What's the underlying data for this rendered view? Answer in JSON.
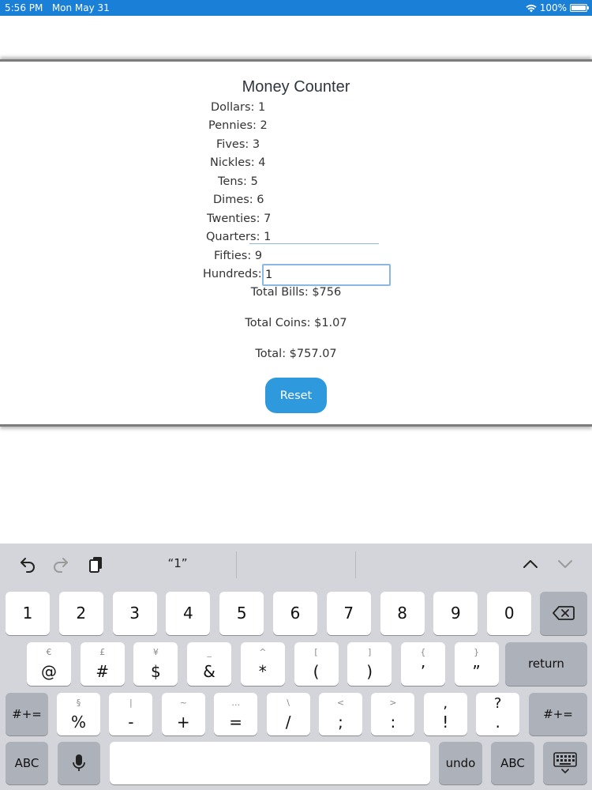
{
  "status_bar": {
    "time": "5:56 PM",
    "date": "Mon May 31",
    "battery": "100%",
    "wifi_icon": "wifi-icon",
    "battery_icon": "battery-icon"
  },
  "app": {
    "title": "Money Counter",
    "fields": [
      {
        "label": "Dollars:",
        "value": "1"
      },
      {
        "label": "Pennies:",
        "value": "2"
      },
      {
        "label": "Fives:",
        "value": "3"
      },
      {
        "label": "Nickles:",
        "value": "4"
      },
      {
        "label": "Tens:",
        "value": "5"
      },
      {
        "label": "Dimes:",
        "value": "6"
      },
      {
        "label": "Twenties:",
        "value": "7"
      },
      {
        "label": "Quarters:",
        "value": "1"
      },
      {
        "label": "Fifties:",
        "value": "9"
      },
      {
        "label": "Hundreds:",
        "value": "1"
      }
    ],
    "total_bills": "Total Bills: $756",
    "total_coins": "Total Coins: $1.07",
    "total": "Total: $757.07",
    "reset_label": "Reset",
    "accent_color": "#2f99dd"
  },
  "keyboard": {
    "suggestion": "“1”",
    "row1": [
      "1",
      "2",
      "3",
      "4",
      "5",
      "6",
      "7",
      "8",
      "9",
      "0"
    ],
    "row2_main": [
      "@",
      "#",
      "$",
      "&",
      "*",
      "(",
      ")",
      "’",
      "”"
    ],
    "row2_alt": [
      "€",
      "£",
      "¥",
      "_",
      "^",
      "[",
      "]",
      "{",
      "}"
    ],
    "row3_main": [
      "%",
      "-",
      "+",
      "=",
      "/",
      ";",
      ":",
      "!",
      "."
    ],
    "row3_alt": [
      "§",
      "|",
      "~",
      "…",
      "\\",
      "<",
      ">",
      "",
      ""
    ],
    "row3_sec": [
      "",
      "",
      "",
      "",
      "",
      "",
      "",
      ",",
      "?"
    ],
    "return_label": "return",
    "symbols_label": "#+=",
    "abc_label": "ABC",
    "undo_label": "undo"
  }
}
